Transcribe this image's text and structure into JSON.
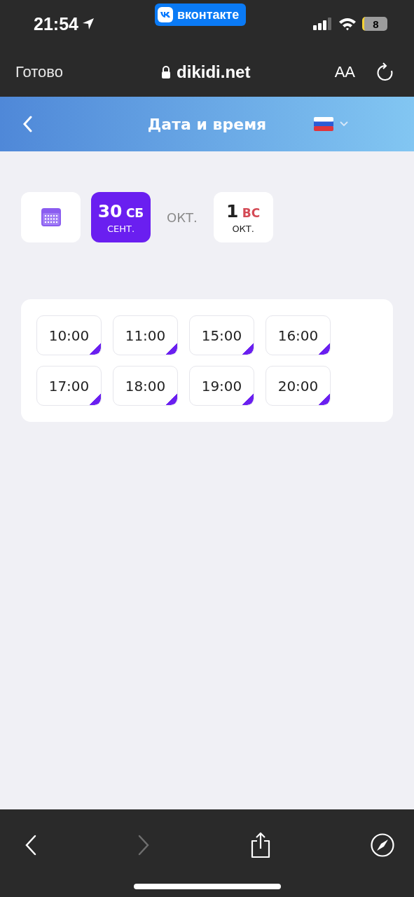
{
  "status_bar": {
    "time": "21:54",
    "app_badge": "вконтакте",
    "battery": "8"
  },
  "browser_bar": {
    "done": "Готово",
    "address": "dikidi.net",
    "text_size": "AA"
  },
  "header": {
    "title": "Дата и время"
  },
  "dates": [
    {
      "kind": "calendar"
    },
    {
      "kind": "day",
      "day": "30",
      "weekday": "СБ",
      "month": "СЕНТ.",
      "selected": true,
      "weekend": false
    },
    {
      "kind": "month",
      "label": "ОКТ."
    },
    {
      "kind": "day",
      "day": "1",
      "weekday": "ВС",
      "month": "ОКТ.",
      "selected": false,
      "weekend": true
    }
  ],
  "time_slots": [
    "10:00",
    "11:00",
    "15:00",
    "16:00",
    "17:00",
    "18:00",
    "19:00",
    "20:00"
  ],
  "toolbar": [
    {
      "kind": "back",
      "disabled": false
    },
    {
      "kind": "forward",
      "disabled": true
    },
    {
      "kind": "share",
      "disabled": false
    },
    {
      "kind": "compass",
      "disabled": false
    }
  ]
}
